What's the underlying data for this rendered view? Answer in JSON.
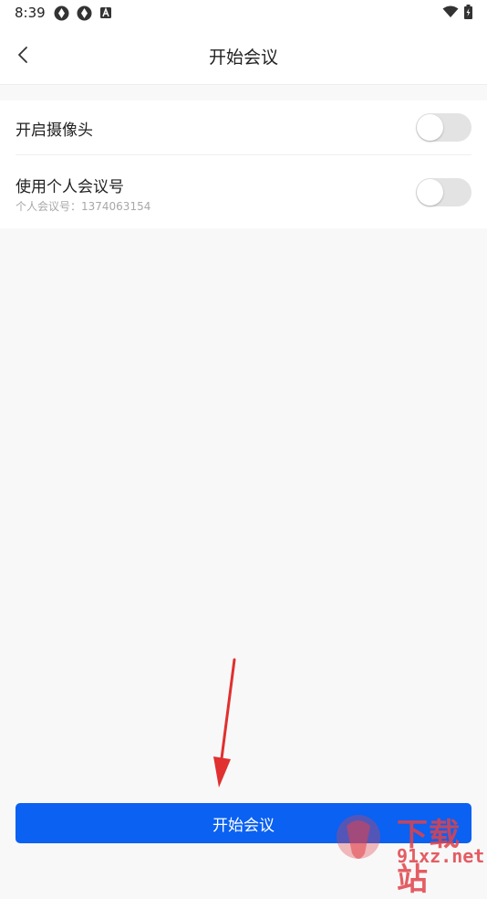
{
  "status_bar": {
    "time": "8:39"
  },
  "navbar": {
    "title": "开始会议"
  },
  "settings": {
    "camera": {
      "label": "开启摄像头",
      "enabled": false
    },
    "personal_meeting_id": {
      "label": "使用个人会议号",
      "sub": "个人会议号：1374063154",
      "enabled": false
    }
  },
  "start_button": {
    "label": "开始会议"
  },
  "watermark": {
    "top": "下载站",
    "bottom": "91xz.net"
  },
  "colors": {
    "accent": "#0a61f2",
    "toggle_off": "#e3e3e3",
    "annotation_arrow": "#e0302f"
  }
}
